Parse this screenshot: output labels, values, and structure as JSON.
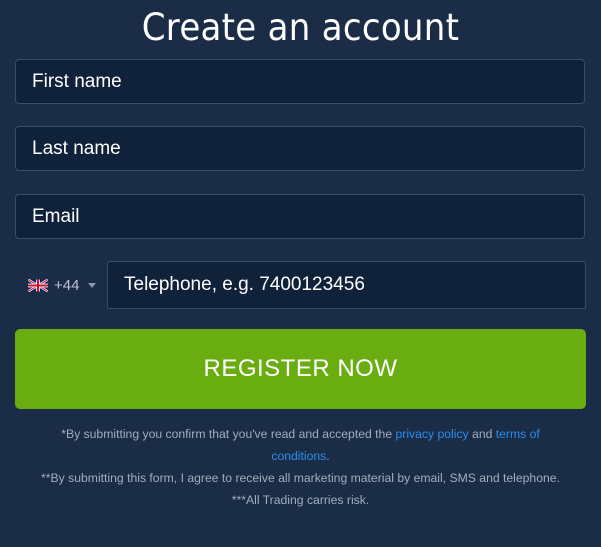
{
  "form": {
    "title": "Create an account",
    "first_name_placeholder": "First name",
    "last_name_placeholder": "Last name",
    "email_placeholder": "Email",
    "phone": {
      "flag_icon": "uk-flag-icon",
      "dial_code": "+44",
      "placeholder": "Telephone, e.g. 7400123456"
    },
    "register_label": "REGISTER NOW"
  },
  "disclaimer": {
    "line1_prefix": "*By submitting you confirm that you've read and accepted the ",
    "privacy_link": "privacy policy",
    "line1_and": " and ",
    "terms_link": "terms of conditions",
    "line1_suffix": ".",
    "line2": "**By submitting this form, I agree to receive all marketing material by email, SMS and telephone.",
    "line3": "***All Trading carries risk."
  },
  "colors": {
    "background": "#1a2c46",
    "field_background": "#10213a",
    "button": "#6aad10",
    "link": "#2a8ef0"
  }
}
